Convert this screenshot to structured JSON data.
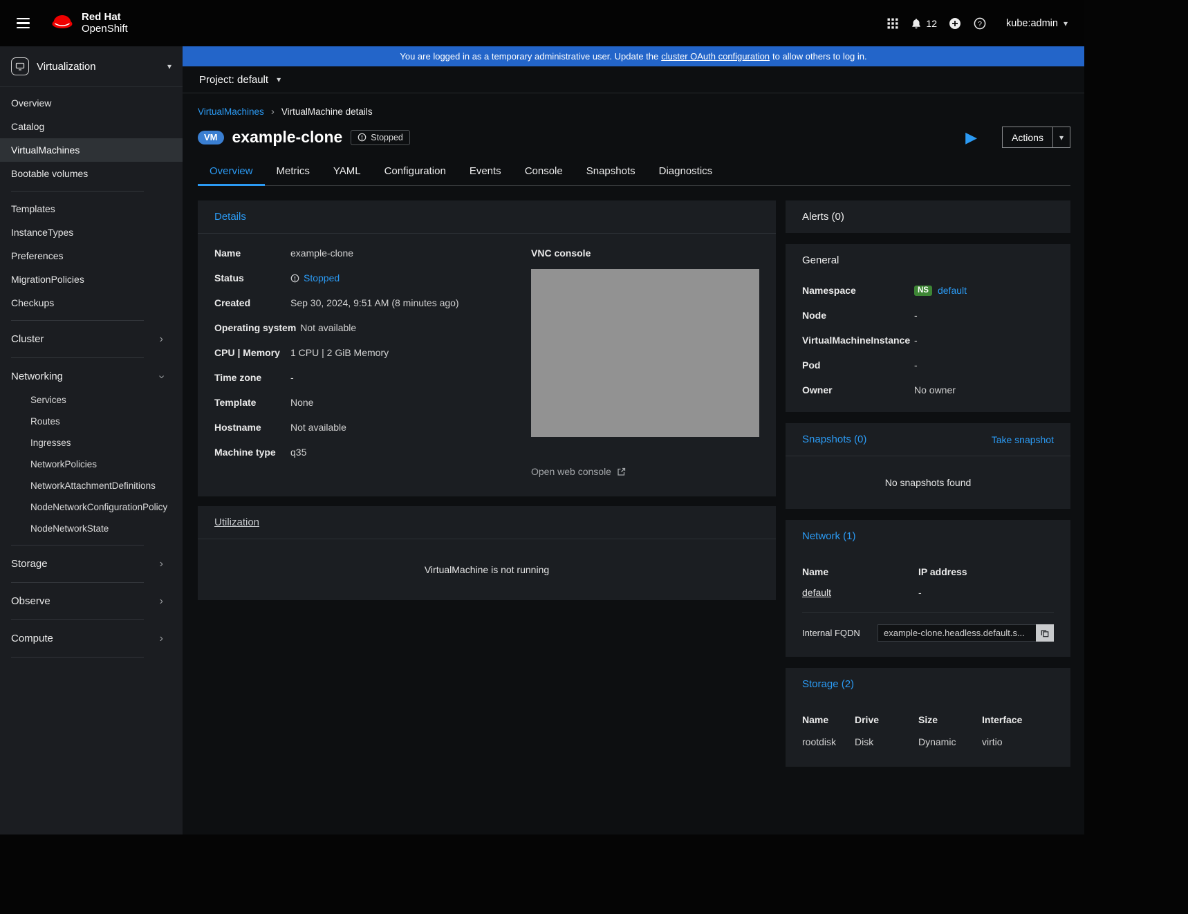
{
  "colors": {
    "accent_blue": "#2b9af3",
    "banner_blue": "#2365c9",
    "brand_red": "#ee0000",
    "vm_badge_blue": "#3a7fd2",
    "ns_badge_green": "#3e8635",
    "vnc_placeholder_gray": "#929292"
  },
  "header": {
    "brand_line1": "Red Hat",
    "brand_line2": "OpenShift",
    "notification_count": "12",
    "user_menu": "kube:admin"
  },
  "banner": {
    "text_before": "You are logged in as a temporary administrative user. Update the",
    "link_text": "cluster OAuth configuration",
    "text_after": "to allow others to log in."
  },
  "project_bar": {
    "label": "Project: default"
  },
  "sidebar": {
    "perspective": "Virtualization",
    "items": [
      "Overview",
      "Catalog",
      "VirtualMachines",
      "Bootable volumes"
    ],
    "active_item": "VirtualMachines",
    "group2": [
      "Templates",
      "InstanceTypes",
      "Preferences",
      "MigrationPolicies",
      "Checkups"
    ],
    "cluster": "Cluster",
    "networking": "Networking",
    "networking_children": [
      "Services",
      "Routes",
      "Ingresses",
      "NetworkPolicies",
      "NetworkAttachmentDefinitions",
      "NodeNetworkConfigurationPolicy",
      "NodeNetworkState"
    ],
    "bottom": [
      "Storage",
      "Observe",
      "Compute"
    ]
  },
  "breadcrumb": {
    "parent": "VirtualMachines",
    "current": "VirtualMachine details"
  },
  "title": {
    "kind_badge": "VM",
    "name": "example-clone",
    "status": "Stopped"
  },
  "actions": {
    "label": "Actions"
  },
  "tabs": [
    "Overview",
    "Metrics",
    "YAML",
    "Configuration",
    "Events",
    "Console",
    "Snapshots",
    "Diagnostics"
  ],
  "active_tab": "Overview",
  "details": {
    "header": "Details",
    "rows": [
      {
        "label": "Name",
        "value": "example-clone"
      },
      {
        "label": "Status",
        "value": "Stopped"
      },
      {
        "label": "Created",
        "value": "Sep 30, 2024, 9:51 AM (8 minutes ago)"
      },
      {
        "label": "Operating system",
        "value": "Not available"
      },
      {
        "label": "CPU | Memory",
        "value": "1 CPU | 2 GiB Memory"
      },
      {
        "label": "Time zone",
        "value": "-"
      },
      {
        "label": "Template",
        "value": "None"
      },
      {
        "label": "Hostname",
        "value": "Not available"
      },
      {
        "label": "Machine type",
        "value": "q35"
      }
    ],
    "vnc_label": "VNC console",
    "open_console": "Open web console"
  },
  "utilization": {
    "header": "Utilization",
    "empty": "VirtualMachine is not running"
  },
  "alerts": {
    "header": "Alerts (0)"
  },
  "general": {
    "header": "General",
    "rows": [
      {
        "label": "Namespace",
        "badge": "NS",
        "value": "default"
      },
      {
        "label": "Node",
        "value": "-"
      },
      {
        "label": "VirtualMachineInstance",
        "value": "-"
      },
      {
        "label": "Pod",
        "value": "-"
      },
      {
        "label": "Owner",
        "value": "No owner"
      }
    ]
  },
  "snapshots": {
    "header": "Snapshots (0)",
    "action": "Take snapshot",
    "empty": "No snapshots found"
  },
  "network": {
    "header": "Network (1)",
    "columns": [
      "Name",
      "IP address"
    ],
    "rows": [
      {
        "name": "default",
        "ip": "-"
      }
    ],
    "fqdn_label": "Internal FQDN",
    "fqdn_value": "example-clone.headless.default.s..."
  },
  "storage": {
    "header": "Storage (2)",
    "columns": [
      "Name",
      "Drive",
      "Size",
      "Interface"
    ],
    "rows": [
      {
        "name": "rootdisk",
        "drive": "Disk",
        "size": "Dynamic",
        "interface": "virtio"
      }
    ]
  }
}
